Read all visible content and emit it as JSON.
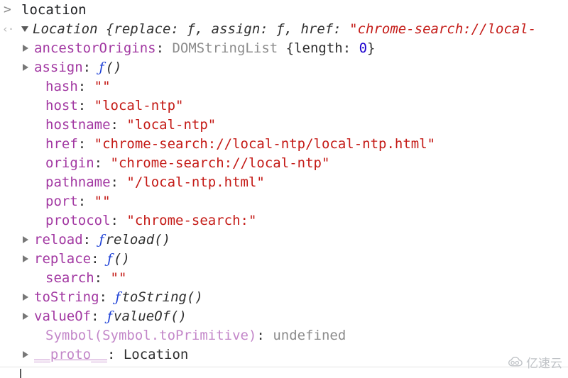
{
  "console": {
    "prompt_symbol": ">",
    "result_symbol": "‹·",
    "input_expression": "location",
    "bottom_prompt_caret": true
  },
  "result_object": {
    "header": {
      "expanded": true,
      "class_name": "Location",
      "preview": " {replace: ƒ, assign: ƒ, href: ",
      "preview_string": "\"chrome-search://local-",
      "truncated": true
    },
    "properties": [
      {
        "name": "ancestorOrigins",
        "expandable": true,
        "value_kind": "object",
        "value_class": "DOMStringList",
        "value_brace_open": " {length: ",
        "value_number": "0",
        "value_brace_close": "}"
      },
      {
        "name": "assign",
        "expandable": true,
        "value_kind": "function",
        "fn_mark": "ƒ",
        "fn_name": "()"
      },
      {
        "name": "hash",
        "expandable": false,
        "value_kind": "string",
        "value": "\"\""
      },
      {
        "name": "host",
        "expandable": false,
        "value_kind": "string",
        "value": "\"local-ntp\""
      },
      {
        "name": "hostname",
        "expandable": false,
        "value_kind": "string",
        "value": "\"local-ntp\""
      },
      {
        "name": "href",
        "expandable": false,
        "value_kind": "string",
        "value": "\"chrome-search://local-ntp/local-ntp.html\""
      },
      {
        "name": "origin",
        "expandable": false,
        "value_kind": "string",
        "value": "\"chrome-search://local-ntp\""
      },
      {
        "name": "pathname",
        "expandable": false,
        "value_kind": "string",
        "value": "\"/local-ntp.html\""
      },
      {
        "name": "port",
        "expandable": false,
        "value_kind": "string",
        "value": "\"\""
      },
      {
        "name": "protocol",
        "expandable": false,
        "value_kind": "string",
        "value": "\"chrome-search:\""
      },
      {
        "name": "reload",
        "expandable": true,
        "value_kind": "function",
        "fn_mark": "ƒ",
        "fn_name": "reload()"
      },
      {
        "name": "replace",
        "expandable": true,
        "value_kind": "function",
        "fn_mark": "ƒ",
        "fn_name": "()"
      },
      {
        "name": "search",
        "expandable": false,
        "value_kind": "string",
        "value": "\"\""
      },
      {
        "name": "toString",
        "expandable": true,
        "value_kind": "function",
        "fn_mark": "ƒ",
        "fn_name": "toString()"
      },
      {
        "name": "valueOf",
        "expandable": true,
        "value_kind": "function",
        "fn_mark": "ƒ",
        "fn_name": "valueOf()"
      },
      {
        "name": "Symbol(Symbol.toPrimitive)",
        "expandable": false,
        "name_style": "symbol",
        "value_kind": "undefined",
        "value": "undefined"
      },
      {
        "name": "__proto__",
        "expandable": true,
        "name_style": "proto",
        "value_kind": "proto",
        "value": "Location"
      }
    ]
  },
  "watermark": {
    "text": "亿速云",
    "icon": "cloud-logo-icon"
  },
  "colors": {
    "property_name": "#a238a2",
    "string_value": "#c41a16",
    "number_value": "#1c00cf",
    "function_mark": "#1c3fd6",
    "gray_text": "#8c8c8c",
    "dark_text": "#303030",
    "symbol_name": "#c387c9",
    "background": "#ffffff"
  }
}
